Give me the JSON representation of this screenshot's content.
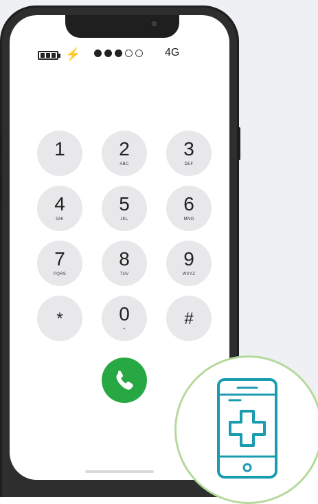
{
  "status_bar": {
    "signal_strength": 3,
    "signal_max": 5,
    "network": "4G",
    "battery_icon": "battery-full-icon",
    "charging_icon": "lightning-bolt-icon"
  },
  "keypad": {
    "keys": [
      {
        "digit": "1",
        "letters": ""
      },
      {
        "digit": "2",
        "letters": "ABC"
      },
      {
        "digit": "3",
        "letters": "DEF"
      },
      {
        "digit": "4",
        "letters": "GHI"
      },
      {
        "digit": "5",
        "letters": "JKL"
      },
      {
        "digit": "6",
        "letters": "MNO"
      },
      {
        "digit": "7",
        "letters": "PQRS"
      },
      {
        "digit": "8",
        "letters": "TUV"
      },
      {
        "digit": "9",
        "letters": "WXYZ"
      },
      {
        "digit": "*",
        "letters": ""
      },
      {
        "digit": "0",
        "letters": "+"
      },
      {
        "digit": "#",
        "letters": ""
      }
    ],
    "call_icon": "phone-handset-icon"
  },
  "badge": {
    "icon": "mobile-health-cross-icon"
  },
  "colors": {
    "call_green": "#27a843",
    "key_gray": "#e8e8ea",
    "badge_ring": "#b5d99c",
    "icon_teal": "#1a9cb0"
  }
}
